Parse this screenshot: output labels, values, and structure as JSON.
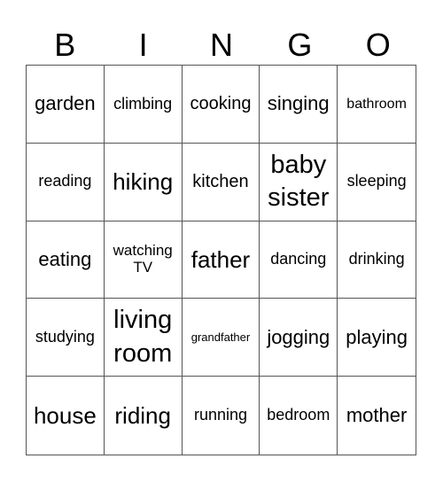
{
  "header": [
    "B",
    "I",
    "N",
    "G",
    "O"
  ],
  "cells": [
    "garden",
    "climbing",
    "cooking",
    "singing",
    "bathroom",
    "reading",
    "hiking",
    "kitchen",
    "baby sister",
    "sleeping",
    "eating",
    "watching TV",
    "father",
    "dancing",
    "drinking",
    "studying",
    "living room",
    "grandfather",
    "jogging",
    "playing",
    "house",
    "riding",
    "running",
    "bedroom",
    "mother"
  ]
}
